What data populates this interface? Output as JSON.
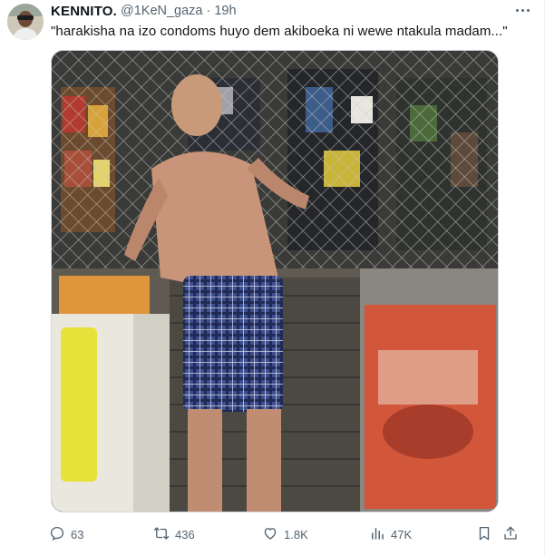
{
  "tweet": {
    "author": {
      "name": "KENNITO.",
      "handle": "@1KeN_gaza",
      "time": "19h"
    },
    "separator": "·",
    "text": "\"harakisha na izo condoms huyo dem akiboeka ni wewe ntakula madam...\"",
    "media": {
      "alt": ""
    }
  },
  "actions": {
    "replies": "63",
    "retweets": "436",
    "likes": "1.8K",
    "views": "47K"
  },
  "icons": [
    "avatar",
    "more-icon",
    "reply-icon",
    "retweet-icon",
    "like-icon",
    "views-icon",
    "bookmark-icon",
    "share-icon"
  ],
  "colors": {
    "text": "#0f1419",
    "secondary": "#536471",
    "border": "#cfd9de"
  }
}
